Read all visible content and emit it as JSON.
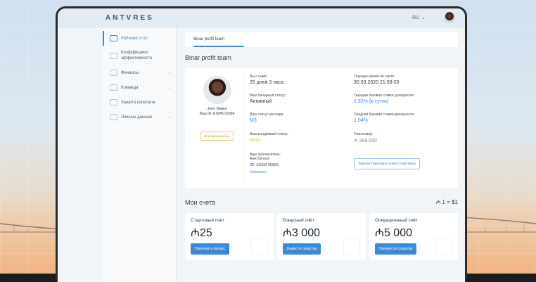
{
  "header": {
    "logo": "ANTVRES",
    "lang": "RU"
  },
  "sidebar": {
    "items": [
      {
        "label": "Рабочий стол",
        "active": true,
        "icon": "home-icon"
      },
      {
        "label": "Коэффициент эффективности",
        "icon": "gauge-icon"
      },
      {
        "label": "Финансы",
        "icon": "wallet-icon",
        "chevron": true
      },
      {
        "label": "Команда",
        "icon": "team-icon",
        "chevron": true
      },
      {
        "label": "Защита капитала",
        "icon": "shield-icon"
      },
      {
        "label": "Личные данные",
        "icon": "user-icon",
        "chevron": true
      }
    ]
  },
  "tabs": [
    {
      "label": "Binar profit team"
    }
  ],
  "page_title": "Binar profit team",
  "profile": {
    "name": "John Males",
    "id": "Ваш ID: ES045 00684",
    "verify": "Верифицировано",
    "fields": [
      {
        "label": "Вы с нами:",
        "value": "25 дней 3 часа",
        "color": "dark"
      },
      {
        "label": "Текущее время на сайте:",
        "value": "30.03.2020 21:59:03",
        "color": "dark"
      },
      {
        "label": "Ваш бинарный статус:",
        "value": "Активный",
        "color": "dark"
      },
      {
        "label": "Текущая базовая ставка доходности:",
        "value": "1.32% (в сутки)",
        "color": "blue"
      },
      {
        "label": "Ваш статус ментора:",
        "value": "M3",
        "color": "blue"
      },
      {
        "label": "Средняя базовая ставка доходности:",
        "value": "1.04%",
        "color": "blue"
      },
      {
        "label": "Ваш инидживый статус:",
        "value": "Basic",
        "color": "yellow"
      },
      {
        "label": "Спилловер:",
        "value": "₼ 368.000",
        "color": "purple"
      }
    ],
    "inviter_label": "Ваш пригласитель:",
    "inviter_name": "Alex Benidor",
    "inviter_id": "(ID: ES032 00365)",
    "contact": "Связаться",
    "register_button": "Зарегистрировать нового партнёра"
  },
  "accounts": {
    "title": "Мои счета",
    "rate": "₼ 1 = $1",
    "cards": [
      {
        "label": "Стартовый счёт",
        "value": "₼25",
        "button": "Пополнить баланс"
      },
      {
        "label": "Бонусный счёт",
        "value": "₼3 000",
        "button": "Вывести средства"
      },
      {
        "label": "Операционный счёт",
        "value": "₼5 000",
        "button": "Перевести средства"
      }
    ]
  },
  "colors": {
    "accent": "#3b8ad9",
    "yellow": "#e6c24a",
    "purple": "#9b74d8"
  }
}
